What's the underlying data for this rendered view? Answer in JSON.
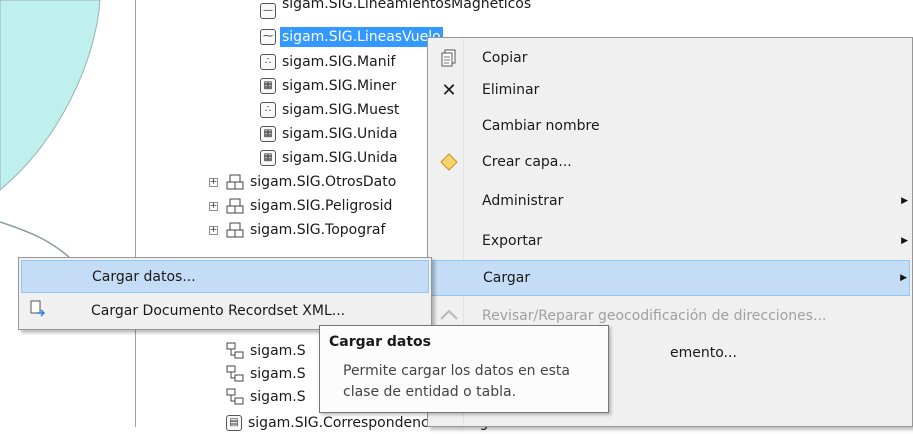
{
  "tree": {
    "items": [
      {
        "label": "sigam.SIG.LineamientosMagneticos"
      },
      {
        "label": "sigam.SIG.LineasVuelo"
      },
      {
        "label": "sigam.SIG.Manif"
      },
      {
        "label": "sigam.SIG.Miner"
      },
      {
        "label": "sigam.SIG.Muest"
      },
      {
        "label": "sigam.SIG.Unida"
      },
      {
        "label": "sigam.SIG.Unida"
      },
      {
        "label": "sigam.SIG.OtrosDato"
      },
      {
        "label": "sigam.SIG.Peligrosid"
      },
      {
        "label": "sigam.SIG.Topograf"
      },
      {
        "label": "sigam.S"
      },
      {
        "label": "sigam.S"
      },
      {
        "label": "sigam.S"
      },
      {
        "label": "sigam.SIG.CorrespondenciaLitologica"
      }
    ]
  },
  "context_menu": {
    "items": [
      {
        "label": "Copiar",
        "icon": "copy-icon"
      },
      {
        "label": "Eliminar",
        "icon": "delete-x-icon"
      },
      {
        "label": "Cambiar nombre"
      },
      {
        "label": "Crear capa...",
        "icon": "layer-diamond-icon"
      },
      {
        "label": "Administrar"
      },
      {
        "label": "Exportar"
      },
      {
        "label": "Cargar"
      },
      {
        "label": "Revisar/Reparar geocodificación de direcciones..."
      },
      {
        "label": "emento..."
      }
    ]
  },
  "submenu": {
    "items": [
      {
        "label": "Cargar datos..."
      },
      {
        "label": "Cargar Documento Recordset XML..."
      }
    ]
  },
  "tooltip": {
    "title": "Cargar datos",
    "body": "Permite cargar los datos en esta clase de entidad o tabla."
  },
  "colors": {
    "selection": "#3399ff",
    "menu_bg": "#f0f0f0",
    "menu_highlight": "#c4dcf5",
    "map_fill": "#bff0ee"
  }
}
